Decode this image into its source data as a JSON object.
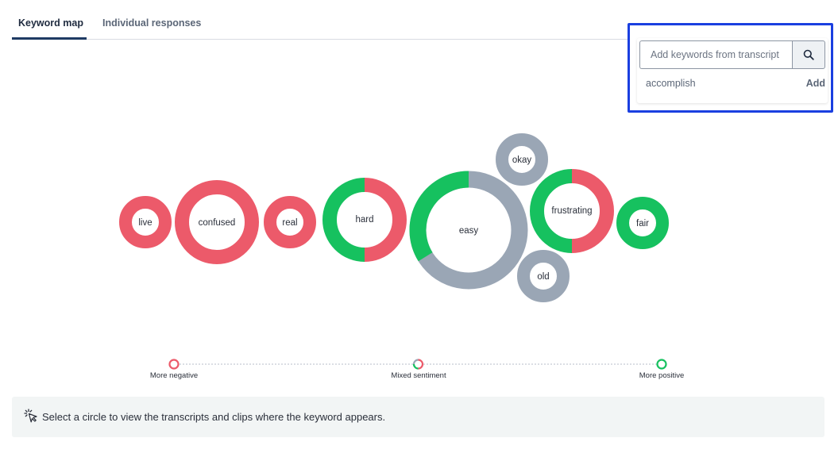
{
  "tabs": [
    {
      "label": "Keyword map",
      "active": true
    },
    {
      "label": "Individual responses",
      "active": false
    }
  ],
  "keyword_search": {
    "placeholder": "Add keywords from transcript",
    "suggestion": "accomplish",
    "add_label": "Add",
    "icon": "search-icon"
  },
  "colors": {
    "negative": "#ec5a6a",
    "positive": "#16c15f",
    "neutral": "#9aa6b5",
    "highlight": "#1a3fe0"
  },
  "keywords": [
    {
      "word": "live",
      "sentiment": "negative"
    },
    {
      "word": "confused",
      "sentiment": "negative"
    },
    {
      "word": "real",
      "sentiment": "negative"
    },
    {
      "word": "hard",
      "sentiment": "mixed",
      "segments": {
        "positive": 0.5,
        "negative": 0.5
      }
    },
    {
      "word": "easy",
      "sentiment": "mixed",
      "segments": {
        "neutral": 0.67,
        "positive": 0.33
      }
    },
    {
      "word": "okay",
      "sentiment": "neutral"
    },
    {
      "word": "frustrating",
      "sentiment": "mixed",
      "segments": {
        "negative": 0.5,
        "positive": 0.5
      }
    },
    {
      "word": "old",
      "sentiment": "neutral"
    },
    {
      "word": "fair",
      "sentiment": "positive"
    }
  ],
  "legend": {
    "negative": "More negative",
    "mixed": "Mixed sentiment",
    "positive": "More positive"
  },
  "info": {
    "icon": "cursor-click-icon",
    "text": "Select a circle to view the transcripts and clips where the keyword appears."
  }
}
